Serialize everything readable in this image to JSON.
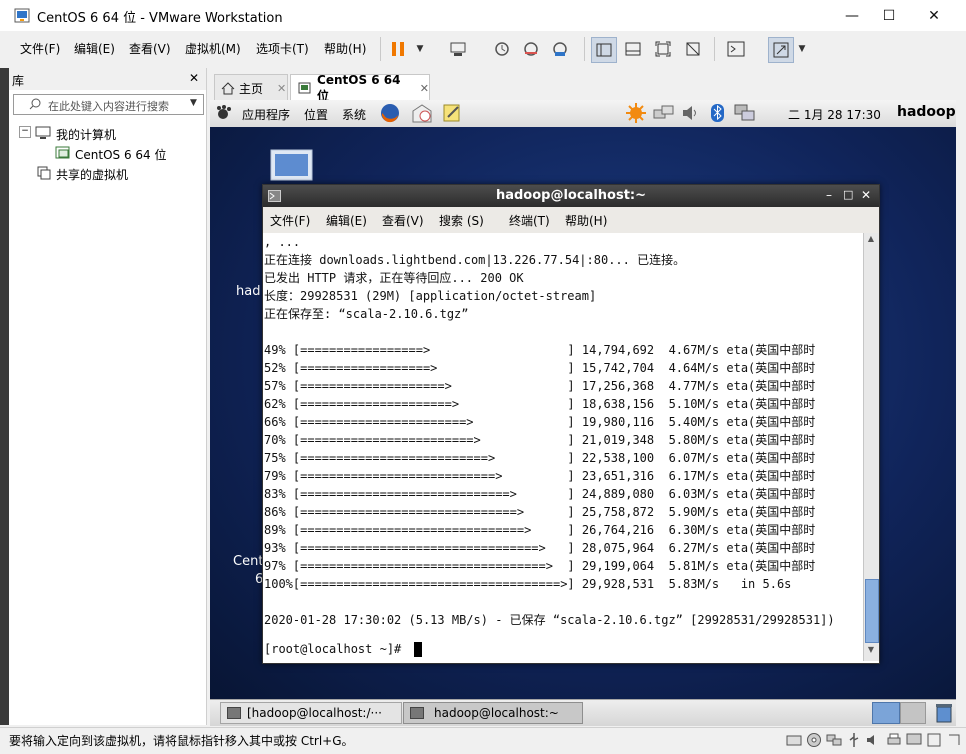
{
  "window": {
    "title": "CentOS 6 64 位 - VMware Workstation",
    "minimize": "—",
    "maximize": "☐",
    "close": "✕"
  },
  "menu": [
    "文件(F)",
    "编辑(E)",
    "查看(V)",
    "虚拟机(M)",
    "选项卡(T)",
    "帮助(H)"
  ],
  "library": {
    "title": "库",
    "close": "✕",
    "search_placeholder": "在此处键入内容进行搜索",
    "tree": {
      "root": "我的计算机",
      "vm": "CentOS 6 64 位",
      "shared": "共享的虚拟机"
    }
  },
  "tabs": [
    {
      "label": "主页",
      "close": "✕"
    },
    {
      "label": "CentOS 6 64 位",
      "close": "✕"
    }
  ],
  "gnome_panel": {
    "apps": "应用程序",
    "places": "位置",
    "system": "系统",
    "clock": "二 1月 28 17:30",
    "user": "hadoop"
  },
  "desktop": {
    "icon_label_1": "had",
    "icon_label_2": "Cent",
    "icon_label_3": "6"
  },
  "terminal": {
    "title": "hadoop@localhost:~",
    "menu": [
      "文件(F)",
      "编辑(E)",
      "查看(V)",
      "搜索 (S)",
      "终端(T)",
      "帮助(H)"
    ],
    "lines": [
      ", ...",
      "正在连接 downloads.lightbend.com|13.226.77.54|:80... 已连接。",
      "已发出 HTTP 请求，正在等待回应... 200 OK",
      "长度：29928531 (29M) [application/octet-stream]",
      "正在保存至: “scala-2.10.6.tgz”",
      "",
      "49% [=================>                   ] 14,794,692  4.67M/s eta(英国中部时",
      "52% [==================>                  ] 15,742,704  4.64M/s eta(英国中部时",
      "57% [====================>                ] 17,256,368  4.77M/s eta(英国中部时",
      "62% [=====================>               ] 18,638,156  5.10M/s eta(英国中部时",
      "66% [=======================>             ] 19,980,116  5.40M/s eta(英国中部时",
      "70% [========================>            ] 21,019,348  5.80M/s eta(英国中部时",
      "75% [==========================>          ] 22,538,100  6.07M/s eta(英国中部时",
      "79% [===========================>         ] 23,651,316  6.17M/s eta(英国中部时",
      "83% [=============================>       ] 24,889,080  6.03M/s eta(英国中部时",
      "86% [==============================>      ] 25,758,872  5.90M/s eta(英国中部时",
      "89% [===============================>     ] 26,764,216  6.30M/s eta(英国中部时",
      "93% [=================================>   ] 28,075,964  6.27M/s eta(英国中部时",
      "97% [==================================>  ] 29,199,064  5.81M/s eta(英国中部时",
      "100%[====================================>] 29,928,531  5.83M/s   in 5.6s",
      "",
      "2020-01-28 17:30:02 (5.13 MB/s) - 已保存 “scala-2.10.6.tgz” [29928531/29928531])",
      "",
      "[root@localhost ~]# "
    ]
  },
  "taskbar": [
    {
      "label": "[hadoop@localhost:/···"
    },
    {
      "label": "hadoop@localhost:~"
    }
  ],
  "status": {
    "text": "要将输入定向到该虚拟机，请将鼠标指针移入其中或按 Ctrl+G。"
  },
  "colors": {
    "desktop": "#10245a",
    "pause_accent": "#f07800",
    "terminal_title": "#333333"
  }
}
